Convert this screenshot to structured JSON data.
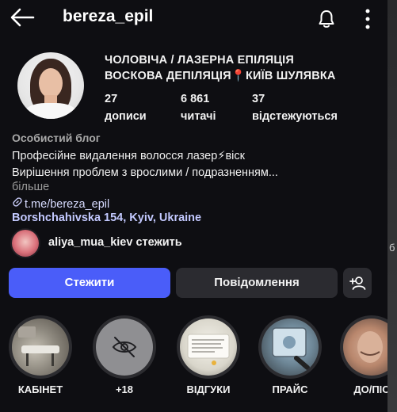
{
  "header": {
    "username": "bereza_epil",
    "icons": [
      "arrow-left-icon",
      "bell-icon",
      "more-vertical-icon"
    ]
  },
  "profile": {
    "headline_line1": "ЧОЛОВІЧА / ЛАЗЕРНА ЕПІЛЯЦІЯ",
    "headline_line2": "ВОСКОВА ДЕПІЛЯЦІЯ📍КИЇВ ШУЛЯВКА",
    "stats": {
      "posts_count": "27",
      "posts_label": "дописи",
      "followers_count": "6 861",
      "followers_label": "читачі",
      "following_count": "37",
      "following_label": "відстежуються"
    },
    "category": "Особистий блог",
    "bio_line1": "Професійне видалення волосся лазер⚡віск",
    "bio_line2": "Вирішення проблем з врослими / подразненням...",
    "more_label": "більше",
    "link": "t.me/bereza_epil",
    "location": "Borshchahivska 154, Kyiv, Ukraine",
    "followed_by": "aliya_mua_kiev стежить"
  },
  "actions": {
    "follow_label": "Стежити",
    "message_label": "Повідомлення"
  },
  "highlights": [
    {
      "label": "КАБІНЕТ"
    },
    {
      "label": "+18"
    },
    {
      "label": "ВІДГУКИ"
    },
    {
      "label": "ПРАЙС"
    },
    {
      "label": "ДО/ПІС"
    }
  ],
  "side_peek": "б",
  "colors": {
    "background": "#0e0e12",
    "accent": "#4a5df9",
    "secondary_button": "#2b2b30",
    "link": "#c3c9ff"
  }
}
